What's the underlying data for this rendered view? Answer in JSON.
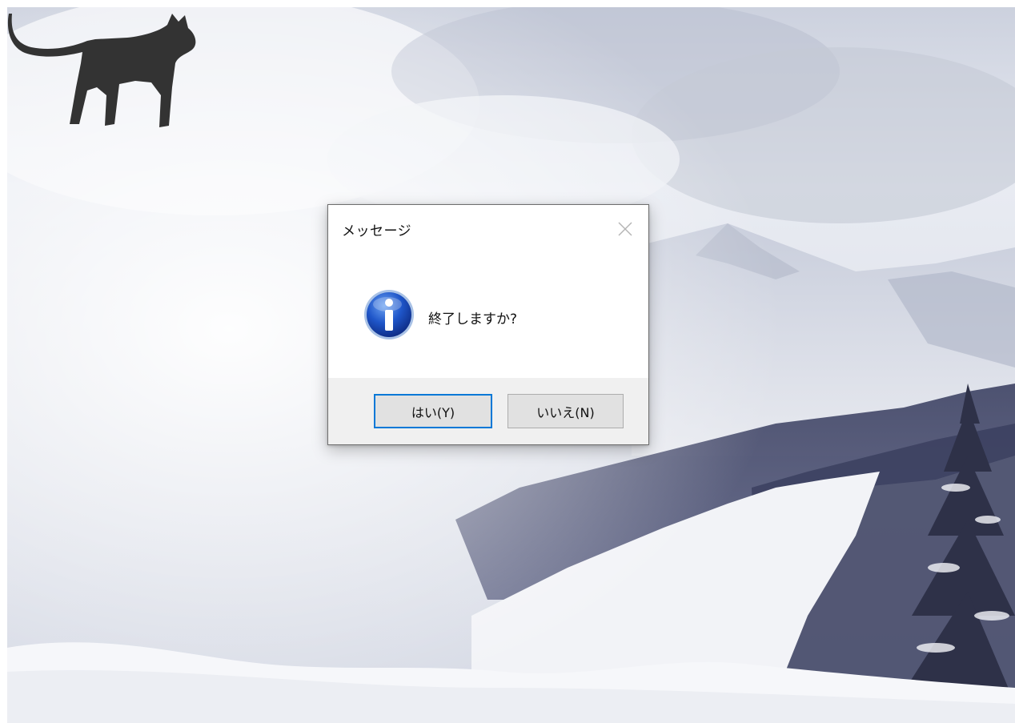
{
  "dialog": {
    "title": "メッセージ",
    "message": "終了しますか?",
    "buttons": {
      "yes_label": "はい(Y)",
      "no_label": "いいえ(N)"
    },
    "icon": "info-icon",
    "close_icon": "close-icon"
  },
  "desktop": {
    "wallpaper": "snowy-mountain-landscape",
    "pet_icon": "cat-silhouette"
  },
  "colors": {
    "dialog_background": "#ffffff",
    "footer_background": "#f0f0f0",
    "default_button_border": "#0078d7",
    "info_icon_blue": "#1f56c9",
    "cat_color": "#333333"
  }
}
